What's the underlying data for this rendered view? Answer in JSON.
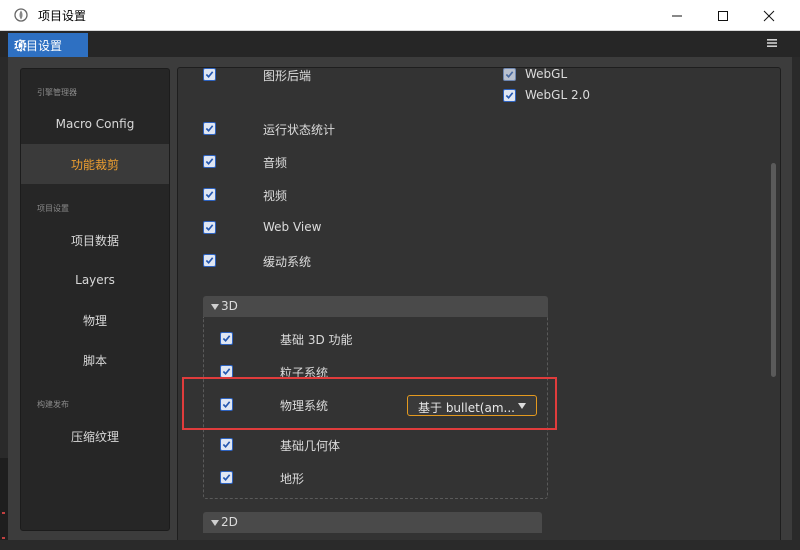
{
  "window": {
    "title": "项目设置",
    "controls": {
      "minimize": "—",
      "maximize": "☐",
      "close": "✕"
    }
  },
  "panel_tab": {
    "label": "项目设置"
  },
  "sidebar": {
    "groups": [
      {
        "label": "引擎管理器"
      },
      {
        "label": "项目设置"
      },
      {
        "label": "构建发布"
      }
    ],
    "items": [
      {
        "label": "Macro Config",
        "active": false
      },
      {
        "label": "功能裁剪",
        "active": true
      },
      {
        "label": "项目数据",
        "active": false
      },
      {
        "label": "Layers",
        "active": false
      },
      {
        "label": "物理",
        "active": false
      },
      {
        "label": "脚本",
        "active": false
      },
      {
        "label": "压缩纹理",
        "active": false
      }
    ]
  },
  "features": {
    "graphics_backend": {
      "label": "图形后端",
      "checked": true,
      "options": [
        {
          "label": "WebGL",
          "checked": true,
          "disabled": true
        },
        {
          "label": "WebGL 2.0",
          "checked": true
        }
      ]
    },
    "items": [
      {
        "label": "运行状态统计",
        "checked": true
      },
      {
        "label": "音频",
        "checked": true
      },
      {
        "label": "视频",
        "checked": true
      },
      {
        "label": "Web View",
        "checked": true
      },
      {
        "label": "缓动系统",
        "checked": true
      }
    ],
    "section_3d": {
      "title": "3D",
      "items": [
        {
          "label": "基础 3D 功能",
          "checked": true
        },
        {
          "label": "粒子系统",
          "checked": true
        },
        {
          "label": "物理系统",
          "checked": true
        },
        {
          "label": "基础几何体",
          "checked": true
        },
        {
          "label": "地形",
          "checked": true
        }
      ],
      "physics_backend": "基于 bullet(am..."
    },
    "section_2d": {
      "title": "2D"
    }
  },
  "colors": {
    "accent": "#f0a030",
    "tab_blue": "#2e70c2",
    "highlight_red": "#e03c3c",
    "dropdown_border": "#e49a1f"
  }
}
